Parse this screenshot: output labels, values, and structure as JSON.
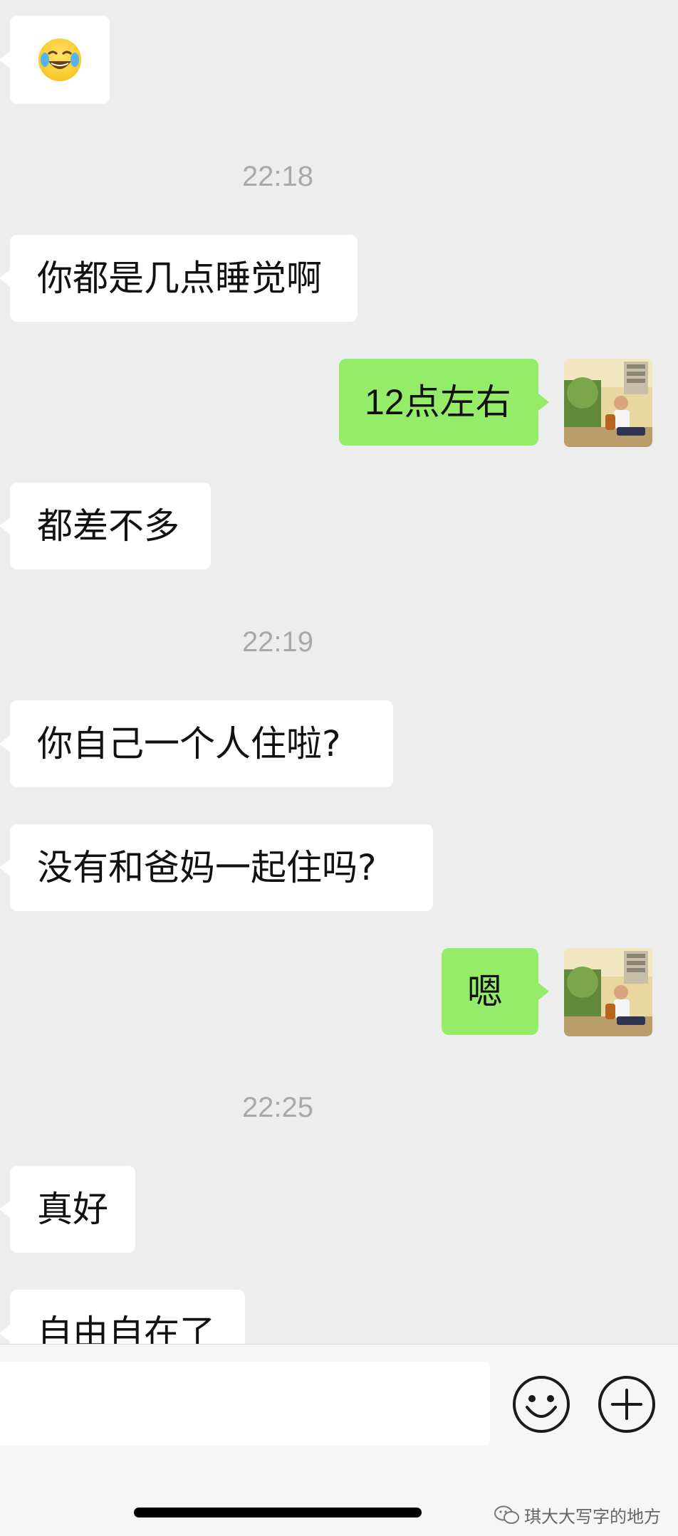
{
  "chat": {
    "messages": [
      {
        "type": "incoming",
        "kind": "emoji",
        "emoji": "😂",
        "emoji_name": "tears-of-joy-emoji"
      },
      {
        "type": "time",
        "text": "22:18"
      },
      {
        "type": "incoming",
        "text": "你都是几点睡觉啊"
      },
      {
        "type": "outgoing",
        "text": "12点左右"
      },
      {
        "type": "incoming",
        "text": "都差不多"
      },
      {
        "type": "time",
        "text": "22:19"
      },
      {
        "type": "incoming",
        "text": "你自己一个人住啦?"
      },
      {
        "type": "incoming",
        "text": "没有和爸妈一起住吗?"
      },
      {
        "type": "outgoing",
        "text": "嗯"
      },
      {
        "type": "time",
        "text": "22:25"
      },
      {
        "type": "incoming",
        "text": "真好"
      },
      {
        "type": "incoming",
        "text": "自由自在了"
      }
    ]
  },
  "input_bar": {
    "placeholder": "",
    "emoji_button_icon": "smiley-face-icon",
    "plus_button_icon": "plus-circle-icon"
  },
  "watermark": {
    "icon": "wechat-logo-icon",
    "text": "琪大大写字的地方"
  },
  "colors": {
    "background": "#ededed",
    "incoming_bubble": "#ffffff",
    "outgoing_bubble": "#95ec69",
    "timestamp": "#a9a9a9"
  }
}
